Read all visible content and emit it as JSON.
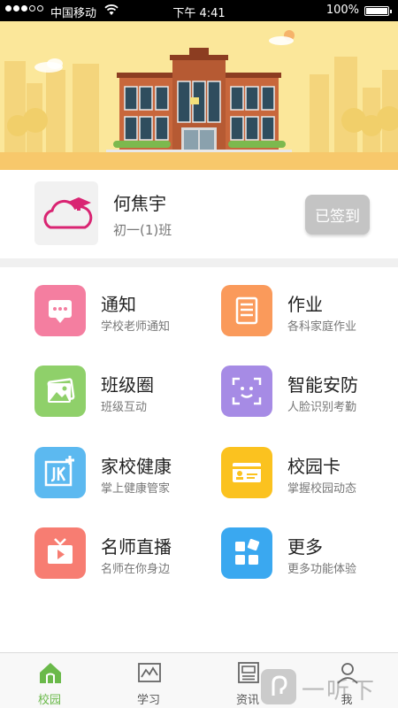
{
  "status_bar": {
    "carrier": "中国移动",
    "time": "下午 4:41",
    "battery": "100%",
    "battery_level": 1.0,
    "signal_bars_filled": 3,
    "signal_bars_total": 5
  },
  "banner": {
    "icon": "school-building-illustration"
  },
  "profile": {
    "name": "何焦宇",
    "class": "初一(1)班",
    "signin_label": "已签到",
    "avatar_icon": "cloud-graduation-cap-icon"
  },
  "features": [
    {
      "title": "通知",
      "subtitle": "学校老师通知",
      "color": "#f47ea0",
      "icon": "chat-bubble-icon"
    },
    {
      "title": "作业",
      "subtitle": "各科家庭作业",
      "color": "#fa9a5b",
      "icon": "document-icon"
    },
    {
      "title": "班级圈",
      "subtitle": "班级互动",
      "color": "#8fd06a",
      "icon": "photo-icon"
    },
    {
      "title": "智能安防",
      "subtitle": "人脸识别考勤",
      "color": "#a68be5",
      "icon": "face-scan-icon"
    },
    {
      "title": "家校健康",
      "subtitle": "掌上健康管家",
      "color": "#5cb9f0",
      "icon": "health-jk-icon"
    },
    {
      "title": "校园卡",
      "subtitle": "掌握校园动态",
      "color": "#fbc21f",
      "icon": "id-card-icon"
    },
    {
      "title": "名师直播",
      "subtitle": "名师在你身边",
      "color": "#f77d72",
      "icon": "tv-play-icon"
    },
    {
      "title": "更多",
      "subtitle": "更多功能体验",
      "color": "#3aa8f0",
      "icon": "apps-grid-icon"
    }
  ],
  "tabs": [
    {
      "label": "校园",
      "icon": "home-icon",
      "active": true
    },
    {
      "label": "学习",
      "icon": "chart-icon",
      "active": false
    },
    {
      "label": "资讯",
      "icon": "news-icon",
      "active": false
    },
    {
      "label": "我",
      "icon": "user-icon",
      "active": false
    }
  ],
  "colors": {
    "accent_green": "#6ab94a",
    "banner_bg": "#fbe79a",
    "signin_bg": "#c4c4c4"
  },
  "watermark": {
    "text": "一听下载",
    "icon": "ear-listen-icon"
  }
}
